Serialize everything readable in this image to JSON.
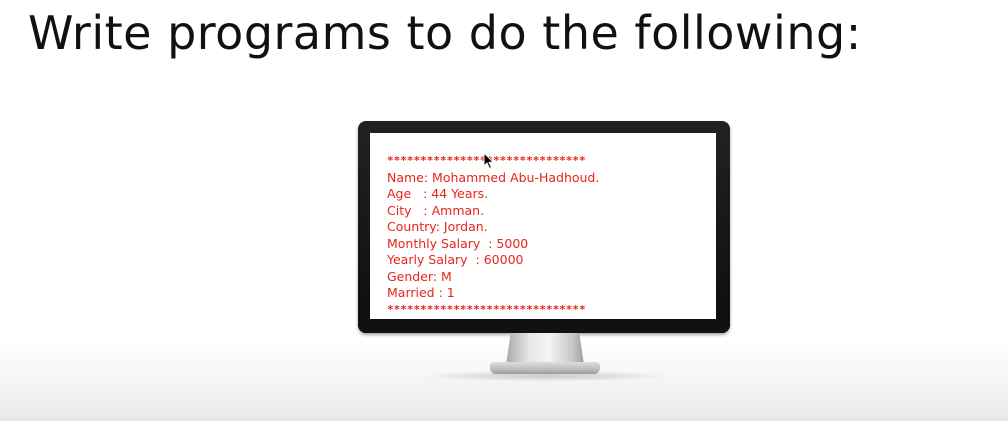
{
  "slide": {
    "title": "Write programs to do the following:"
  },
  "console": {
    "lines": [
      "******************************",
      "Name: Mohammed Abu-Hadhoud.",
      "Age   : 44 Years.",
      "City   : Amman.",
      "Country: Jordan.",
      "Monthly Salary  : 5000",
      "Yearly Salary  : 60000",
      "Gender: M",
      "Married : 1",
      "******************************"
    ],
    "text_color": "#e8241c"
  },
  "icons": {
    "monitor": "monitor-icon",
    "cursor": "mouse-cursor-icon"
  }
}
